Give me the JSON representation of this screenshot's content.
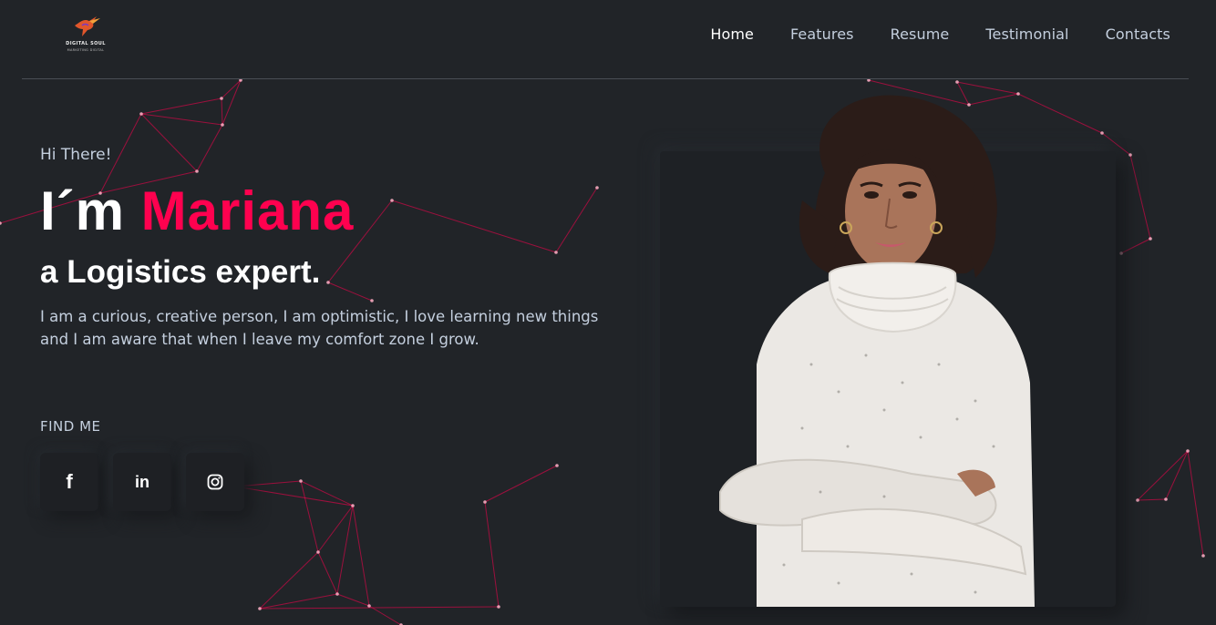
{
  "logo": {
    "title": "DIGITAL SOUL",
    "subtitle": "MARKETING DIGITAL",
    "icon": "hummingbird-icon"
  },
  "nav": [
    {
      "label": "Home",
      "active": true
    },
    {
      "label": "Features",
      "active": false
    },
    {
      "label": "Resume",
      "active": false
    },
    {
      "label": "Testimonial",
      "active": false
    },
    {
      "label": "Contacts",
      "active": false
    }
  ],
  "hero": {
    "greeting": "Hi There!",
    "headline_prefix": "I´m ",
    "name": "Mariana",
    "subhead": "a Logistics expert.",
    "bio": "I am a curious, creative person, I am optimistic, I love learning new things and I am aware that when I leave my comfort zone I grow."
  },
  "find_me": {
    "label": "FIND ME",
    "socials": [
      {
        "icon": "facebook-icon",
        "glyph": "f"
      },
      {
        "icon": "linkedin-icon",
        "glyph": "in"
      },
      {
        "icon": "instagram-icon",
        "glyph": ""
      }
    ]
  },
  "colors": {
    "background": "#212428",
    "accent": "#ff014f",
    "text": "#c4cfde",
    "heading": "#ffffff"
  }
}
